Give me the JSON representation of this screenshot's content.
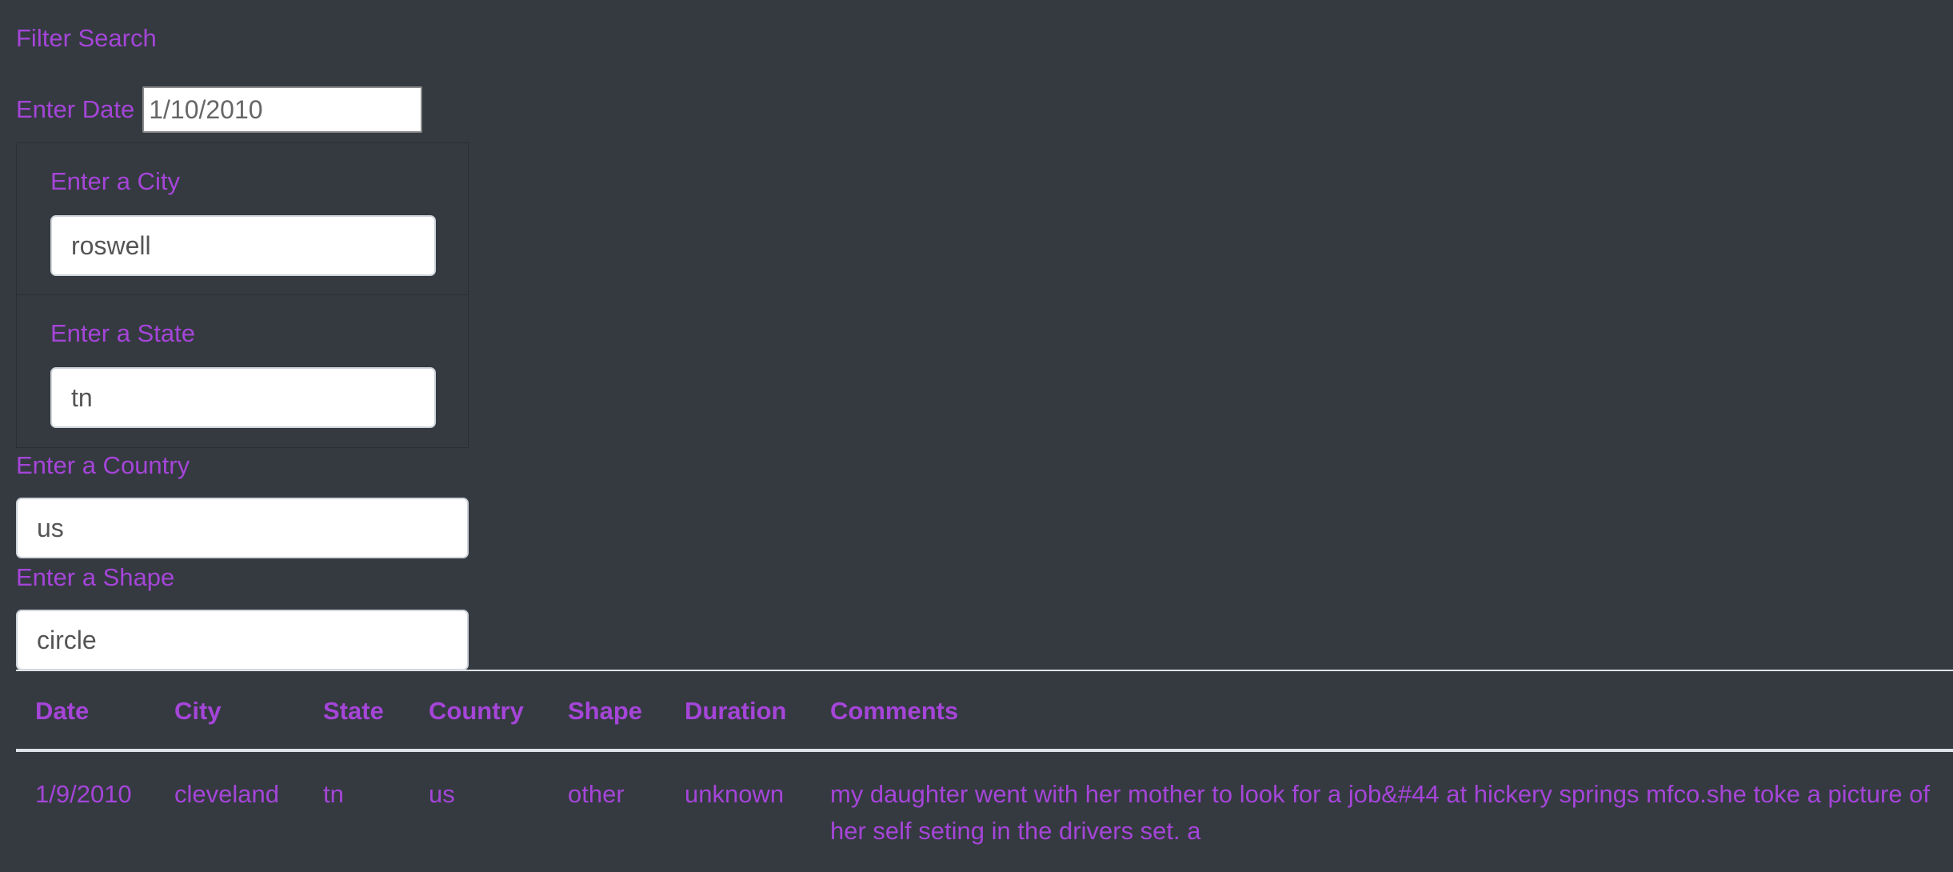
{
  "filter": {
    "title": "Filter Search",
    "date_label": "Enter Date",
    "date_value": "1/10/2010",
    "city_label": "Enter a City",
    "city_value": "roswell",
    "state_label": "Enter a State",
    "state_value": "tn",
    "country_label": "Enter a Country",
    "country_value": "us",
    "shape_label": "Enter a Shape",
    "shape_value": "circle"
  },
  "table": {
    "headers": [
      "Date",
      "City",
      "State",
      "Country",
      "Shape",
      "Duration",
      "Comments"
    ],
    "rows": [
      [
        "1/9/2010",
        "cleveland",
        "tn",
        "us",
        "other",
        "unknown",
        "my daughter went with her mother to look for a job&#44 at hickery springs mfco.she toke a picture of her self seting in the drivers set. a"
      ]
    ]
  },
  "colors": {
    "background": "#343a40",
    "accent_text": "#a545d8"
  }
}
